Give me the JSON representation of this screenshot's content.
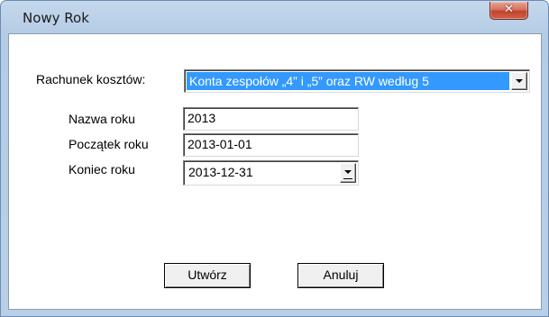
{
  "window": {
    "title": "Nowy Rok",
    "close_glyph": "✕"
  },
  "form": {
    "rachunek_label": "Rachunek kosztów:",
    "rachunek_value": "Konta zespołów „4” i „5” oraz RW według 5",
    "nazwa_label": "Nazwa roku",
    "nazwa_value": "2013",
    "poczatek_label": "Początek roku",
    "poczatek_value": "2013-01-01",
    "koniec_label": "Koniec roku",
    "koniec_value": "2013-12-31"
  },
  "buttons": {
    "create": "Utwórz",
    "cancel": "Anuluj"
  },
  "icons": {
    "dropdown": "chevron-down-icon",
    "close": "close-icon"
  },
  "colors": {
    "selection": "#3399ff",
    "close_button": "#c2442c"
  }
}
